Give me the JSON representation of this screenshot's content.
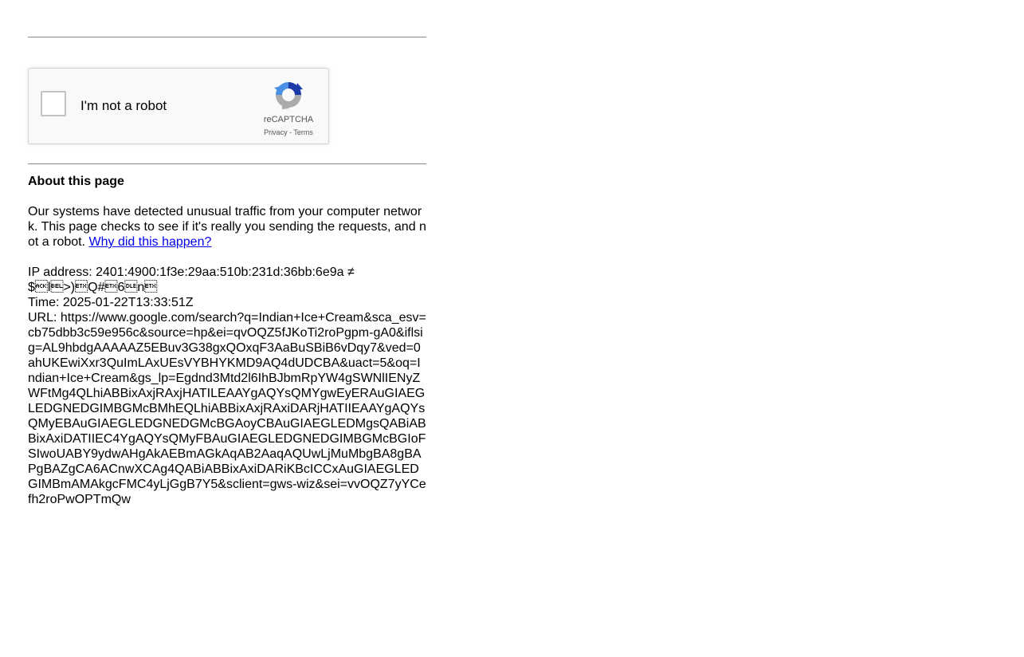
{
  "captcha": {
    "checkbox_label": "I'm not a robot",
    "brand": "reCAPTCHA",
    "privacy_link": "Privacy",
    "separator": " - ",
    "terms_link": "Terms"
  },
  "about": {
    "title": "About this page",
    "body": "Our systems have detected unusual traffic from your computer network. This page checks to see if it's really you sending the requests, and not a robot. ",
    "why_link": "Why did this happen?"
  },
  "details": {
    "ip_label": "IP address: ",
    "ip_value": "2401:4900:1f3e:29aa:510b:231d:36bb:6e9a ≠ $\u0006l\u0007>)\u0003Q#\u00036\u0010n\u0003",
    "time_label": "Time: ",
    "time_value": "2025-01-22T13:33:51Z",
    "url_label": "URL: ",
    "url_value": "https://www.google.com/search?q=Indian+Ice+Cream&sca_esv=cb75dbb3c59e956c&source=hp&ei=qvOQZ5fJKoTi2roPgpm-gA0&iflsig=AL9hbdgAAAAAZ5EBuv3G38gxQOxqF3AaBuSBiB6vDqy7&ved=0ahUKEwiXxr3QuImLAxUEsVYBHYKMD9AQ4dUDCBA&uact=5&oq=Indian+Ice+Cream&gs_lp=Egdnd3Mtd2l6IhBJbmRpYW4gSWNlIENyZWFtMg4QLhiABBixAxjRAxjHATILEAAYgAQYsQMYgwEyERAuGIAEGLEDGNEDGIMBGMcBMhEQLhiABBixAxjRAxiDARjHATIIEAAYgAQYsQMyEBAuGIAEGLEDGNEDGMcBGAoyCBAuGIAEGLEDMgsQABiABBixAxiDATIIEC4YgAQYsQMyFBAuGIAEGLEDGNEDGIMBGMcBGIoFSIwoUABY9ydwAHgAkAEBmAGkAqAB2AaqAQUwLjMuMbgBA8gBAPgBAZgCA6ACnwXCAg4QABiABBixAxiDARiKBcICCxAuGIAEGLEDGIMBmAMAkgcFMC4yLjGgB7Y5&sclient=gws-wiz&sei=vvOQZ7yYCefh2roPwOPTmQw"
  },
  "colors": {
    "link": "#0000ee",
    "rule": "#888888",
    "captcha_bg": "#f9f9f9",
    "captcha_border": "#d3d3d3",
    "recaptcha_blue": "#1c3aa9",
    "recaptcha_lightblue": "#4a90e2",
    "recaptcha_gray": "#ababab"
  }
}
